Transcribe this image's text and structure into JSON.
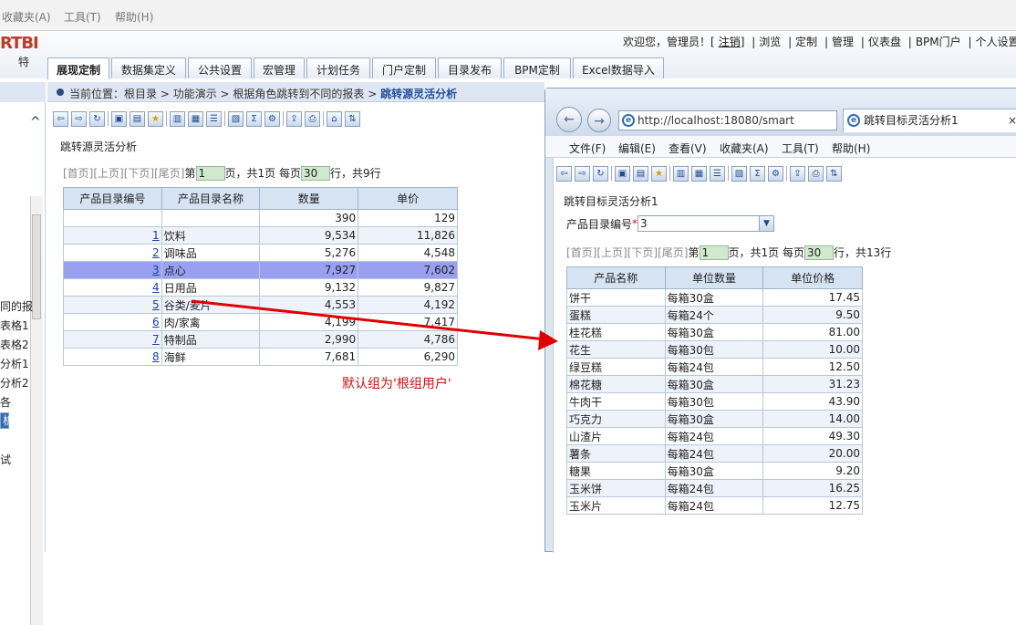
{
  "menubar": {
    "favorites": "收藏夹(A)",
    "tools": "工具(T)",
    "help": "帮助(H)"
  },
  "app": {
    "logo": "RTBI",
    "logo_sub": "特"
  },
  "header": {
    "welcome": "欢迎您，管理员！[",
    "logout": "注销",
    "close_bracket": "]",
    "links": [
      "浏览",
      "定制",
      "管理",
      "仪表盘",
      "BPM门户",
      "个人设置"
    ]
  },
  "tabs": [
    "展现定制",
    "数据集定义",
    "公共设置",
    "宏管理",
    "计划任务",
    "门户定制",
    "目录发布",
    "BPM定制",
    "Excel数据导入"
  ],
  "sidebar": {
    "items": [
      "同的报",
      "表格1",
      "表格2",
      "分析1",
      "分析2",
      "各",
      "析",
      "试"
    ],
    "selected_index": 6
  },
  "breadcrumb": {
    "prefix": "当前位置：",
    "path": "根目录 > 功能演示 > 根据角色跳转到不同的报表 >",
    "current": "跳转源灵活分析"
  },
  "left_report": {
    "title": "跳转源灵活分析",
    "pager": {
      "first": "[首页]",
      "prev": "[上页]",
      "next": "[下页]",
      "last": "[尾页]",
      "page_prefix": "第",
      "page": "1",
      "page_mid": "页，共1页 每页",
      "rows": "30",
      "rows_suffix": "行，共9行"
    },
    "columns": [
      "产品目录编号",
      "产品目录名称",
      "数量",
      "单价"
    ],
    "total": {
      "qty": "390",
      "price": "129"
    },
    "rows": [
      {
        "id": "1",
        "name": "饮料",
        "qty": "9,534",
        "price": "11,826"
      },
      {
        "id": "2",
        "name": "调味品",
        "qty": "5,276",
        "price": "4,548"
      },
      {
        "id": "3",
        "name": "点心",
        "qty": "7,927",
        "price": "7,602"
      },
      {
        "id": "4",
        "name": "日用品",
        "qty": "9,132",
        "price": "9,827"
      },
      {
        "id": "5",
        "name": "谷类/麦片",
        "qty": "4,553",
        "price": "4,192"
      },
      {
        "id": "6",
        "name": "肉/家禽",
        "qty": "4,199",
        "price": "7,417"
      },
      {
        "id": "7",
        "name": "特制品",
        "qty": "2,990",
        "price": "4,786"
      },
      {
        "id": "8",
        "name": "海鲜",
        "qty": "7,681",
        "price": "6,290"
      }
    ],
    "highlight_row": 2
  },
  "annotation": "默认组为'根组用户'",
  "browser": {
    "url": "http://localhost:18080/smart",
    "tab_title": "跳转目标灵活分析1",
    "menu": [
      "文件(F)",
      "编辑(E)",
      "查看(V)",
      "收藏夹(A)",
      "工具(T)",
      "帮助(H)"
    ],
    "report": {
      "title": "跳转目标灵活分析1",
      "param_label": "产品目录编号",
      "param_required": "*",
      "param_value": "3",
      "pager": {
        "first": "[首页]",
        "prev": "[上页]",
        "next": "[下页]",
        "last": "[尾页]",
        "page_prefix": "第",
        "page": "1",
        "page_mid": "页，共1页 每页",
        "rows": "30",
        "rows_suffix": "行，共13行"
      },
      "columns": [
        "产品名称",
        "单位数量",
        "单位价格"
      ],
      "rows": [
        {
          "name": "饼干",
          "unit": "每箱30盒",
          "price": "17.45"
        },
        {
          "name": "蛋糕",
          "unit": "每箱24个",
          "price": "9.50"
        },
        {
          "name": "桂花糕",
          "unit": "每箱30盒",
          "price": "81.00"
        },
        {
          "name": "花生",
          "unit": "每箱30包",
          "price": "10.00"
        },
        {
          "name": "绿豆糕",
          "unit": "每箱24包",
          "price": "12.50"
        },
        {
          "name": "棉花糖",
          "unit": "每箱30盒",
          "price": "31.23"
        },
        {
          "name": "牛肉干",
          "unit": "每箱30包",
          "price": "43.90"
        },
        {
          "name": "巧克力",
          "unit": "每箱30盒",
          "price": "14.00"
        },
        {
          "name": "山渣片",
          "unit": "每箱24包",
          "price": "49.30"
        },
        {
          "name": "薯条",
          "unit": "每箱24包",
          "price": "20.00"
        },
        {
          "name": "糖果",
          "unit": "每箱30盒",
          "price": "9.20"
        },
        {
          "name": "玉米饼",
          "unit": "每箱24包",
          "price": "16.25"
        },
        {
          "name": "玉米片",
          "unit": "每箱24包",
          "price": "12.75"
        }
      ]
    }
  },
  "colors": {
    "accent": "#1f4e9a",
    "highlight": "#9aa0f0",
    "arrow": "#e00000"
  }
}
